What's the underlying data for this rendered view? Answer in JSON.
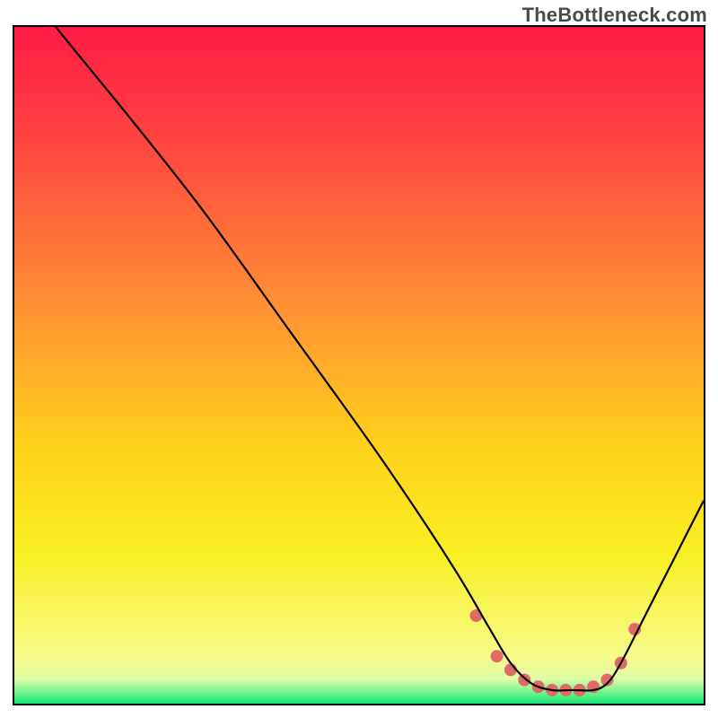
{
  "watermark": "TheBottleneck.com",
  "chart_data": {
    "type": "line",
    "title": "",
    "xlabel": "",
    "ylabel": "",
    "xlim": [
      0,
      100
    ],
    "ylim": [
      0,
      100
    ],
    "grid": false,
    "legend": false,
    "gradient_stops": [
      {
        "offset": 0.0,
        "color": "#ff1b44"
      },
      {
        "offset": 0.18,
        "color": "#ff4840"
      },
      {
        "offset": 0.4,
        "color": "#ff8d35"
      },
      {
        "offset": 0.62,
        "color": "#ffd21b"
      },
      {
        "offset": 0.78,
        "color": "#f9ef24"
      },
      {
        "offset": 0.935,
        "color": "#f6fb8e"
      },
      {
        "offset": 0.965,
        "color": "#d9fca7"
      },
      {
        "offset": 0.988,
        "color": "#55f285"
      },
      {
        "offset": 1.0,
        "color": "#14e477"
      }
    ],
    "series": [
      {
        "name": "main-curve",
        "color": "#000000",
        "x": [
          6,
          10,
          18,
          28,
          40,
          52,
          60,
          65,
          69,
          72,
          75,
          78,
          81,
          84,
          86,
          88,
          92,
          96,
          100
        ],
        "y": [
          100,
          95,
          85,
          72,
          55,
          38,
          26,
          18,
          11,
          6,
          3,
          2,
          2,
          2,
          3,
          6,
          14,
          22,
          30
        ]
      },
      {
        "name": "bottleneck-highlight",
        "color": "#e06a68",
        "style": "markers",
        "marker_radius": 7,
        "x": [
          67,
          70,
          72,
          74,
          76,
          78,
          80,
          82,
          84,
          86,
          88,
          90
        ],
        "y": [
          13,
          7,
          5,
          3.5,
          2.5,
          2,
          2,
          2,
          2.5,
          3.5,
          6,
          11
        ]
      }
    ]
  }
}
